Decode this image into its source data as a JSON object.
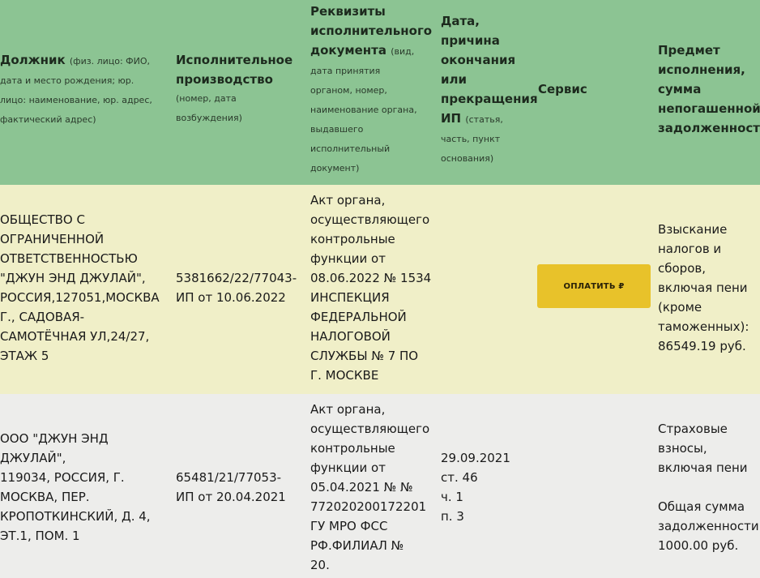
{
  "header": {
    "debtor_title": "Должник",
    "debtor_sub": [
      "(физ. лицо: ФИО,",
      "дата и место рождения; юр.",
      "лицо: наименование, юр. адрес,",
      "фактический адрес)"
    ],
    "proceeding_title": [
      "Исполнительное",
      "производство"
    ],
    "proceeding_sub": [
      "(номер, дата",
      "возбуждения)"
    ],
    "requisites_title": [
      "Реквизиты",
      "исполнительного",
      "документа"
    ],
    "requisites_sub_first": "(вид,",
    "requisites_sub": [
      "дата принятия",
      "органом, номер,",
      "наименование органа,",
      "выдавшего",
      "исполнительный",
      "документ)"
    ],
    "end_title": [
      "Дата,",
      "причина",
      "окончания",
      "или",
      "прекращения",
      "ИП"
    ],
    "end_sub_first": "(статья,",
    "end_sub": [
      "часть, пункт",
      "основания)"
    ],
    "service_title": "Сервис",
    "subject_title": [
      "Предмет",
      "исполнения,",
      "сумма",
      "непогашенной",
      "задолженности"
    ]
  },
  "rows": [
    {
      "debtor": [
        "ОБЩЕСТВО С",
        "ОГРАНИЧЕННОЙ",
        "ОТВЕТСТВЕННОСТЬЮ",
        "\"ДЖУН ЭНД ДЖУЛАЙ\",",
        "РОССИЯ,127051,МОСКВА",
        "Г., САДОВАЯ-",
        "САМОТЁЧНАЯ УЛ,24/27,",
        "ЭТАЖ 5"
      ],
      "proceeding": [
        "5381662/22/77043-",
        "ИП от 10.06.2022"
      ],
      "document": [
        "Акт органа,",
        "осуществляющего",
        "контрольные",
        "функции от",
        "08.06.2022 № 1534",
        "ИНСПЕКЦИЯ",
        "ФЕДЕРАЛЬНОЙ",
        "НАЛОГОВОЙ",
        "СЛУЖБЫ № 7 ПО",
        "Г. МОСКВЕ"
      ],
      "end": [],
      "pay_label": "ОПЛАТИТЬ ₽",
      "subject": [
        "Взыскание",
        "налогов и",
        "сборов,",
        "включая пени",
        "(кроме",
        "таможенных):",
        "86549.19 руб."
      ]
    },
    {
      "debtor": [
        "ООО \"ДЖУН ЭНД",
        "ДЖУЛАЙ\",",
        "119034, РОССИЯ, Г.",
        "МОСКВА, ПЕР.",
        "КРОПОТКИНСКИЙ, Д. 4,",
        "ЭТ.1, ПОМ. 1"
      ],
      "proceeding": [
        "65481/21/77053-",
        "ИП от 20.04.2021"
      ],
      "document": [
        "Акт органа,",
        "осуществляющего",
        "контрольные",
        "функции от",
        "05.04.2021 № №",
        "772020200172201",
        "ГУ МРО ФСС",
        "РФ.ФИЛИАЛ №",
        "20."
      ],
      "end": [
        "29.09.2021",
        "ст. 46",
        "ч. 1",
        "п. 3"
      ],
      "subject": [
        "Страховые",
        "взносы,",
        "включая пени",
        "",
        "Общая сумма",
        "задолженности",
        "1000.00 руб."
      ]
    }
  ]
}
